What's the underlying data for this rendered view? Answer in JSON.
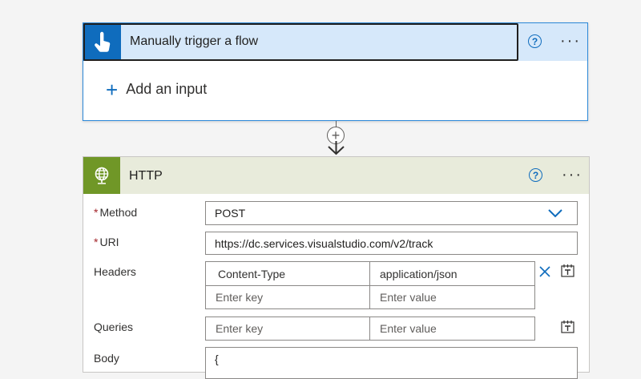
{
  "trigger": {
    "title": "Manually trigger a flow",
    "icon": "touch-hand-icon",
    "help_glyph": "?",
    "more_glyph": "···",
    "add_input_plus": "+",
    "add_input_label": "Add an input"
  },
  "connector": {
    "plus_glyph": "+"
  },
  "http": {
    "title": "HTTP",
    "icon": "globe-icon",
    "help_glyph": "?",
    "more_glyph": "···",
    "required_mark": "*",
    "method": {
      "label": "Method",
      "value": "POST"
    },
    "uri": {
      "label": "URI",
      "value": "https://dc.services.visualstudio.com/v2/track"
    },
    "headers": {
      "label": "Headers",
      "rows": [
        {
          "key": "Content-Type",
          "value": "application/json"
        }
      ],
      "key_placeholder": "Enter key",
      "value_placeholder": "Enter value"
    },
    "queries": {
      "label": "Queries",
      "key_placeholder": "Enter key",
      "value_placeholder": "Enter value"
    },
    "body": {
      "label": "Body",
      "value": "{"
    }
  },
  "colors": {
    "trigger_accent": "#0f6cbd",
    "trigger_header_bg": "#d6e8fa",
    "http_accent": "#709727",
    "http_header_bg": "#e8ebdb",
    "required": "#a4262c"
  }
}
